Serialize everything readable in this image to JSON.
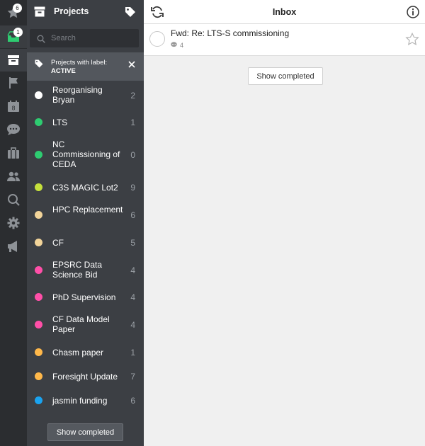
{
  "rail": {
    "starred_badge": "6",
    "inbox_badge": "1"
  },
  "projects": {
    "title": "Projects",
    "search_placeholder": "Search",
    "label_filter": {
      "line1": "Projects with label:",
      "line2": "ACTIVE"
    },
    "items": [
      {
        "name": "Reorganising Bryan",
        "count": "2",
        "color": "#ffffff"
      },
      {
        "name": "LTS",
        "count": "1",
        "color": "#2ecc71"
      },
      {
        "name": "NC Commissioning of CEDA",
        "count": "0",
        "color": "#2ecc71"
      },
      {
        "name": "C3S MAGIC Lot2",
        "count": "9",
        "color": "#c5e03c"
      },
      {
        "name": "HPC Replacement",
        "count": "6",
        "color": "#f2d49a"
      },
      {
        "name": "CF",
        "count": "5",
        "color": "#f2d49a"
      },
      {
        "name": "EPSRC Data Science Bid",
        "count": "4",
        "color": "#ff4fa8"
      },
      {
        "name": "PhD Supervision",
        "count": "4",
        "color": "#ff4fa8"
      },
      {
        "name": "CF Data Model Paper",
        "count": "4",
        "color": "#ff4fa8"
      },
      {
        "name": "Chasm paper",
        "count": "1",
        "color": "#ffb84a"
      },
      {
        "name": "Foresight Update",
        "count": "7",
        "color": "#ffb84a"
      },
      {
        "name": "jasmin funding",
        "count": "6",
        "color": "#1aa3f0"
      }
    ],
    "show_completed": "Show completed"
  },
  "main": {
    "title": "Inbox",
    "task": {
      "title": "Fwd: Re: LTS-S commissioning",
      "comment_count": "4"
    },
    "show_completed": "Show completed"
  }
}
